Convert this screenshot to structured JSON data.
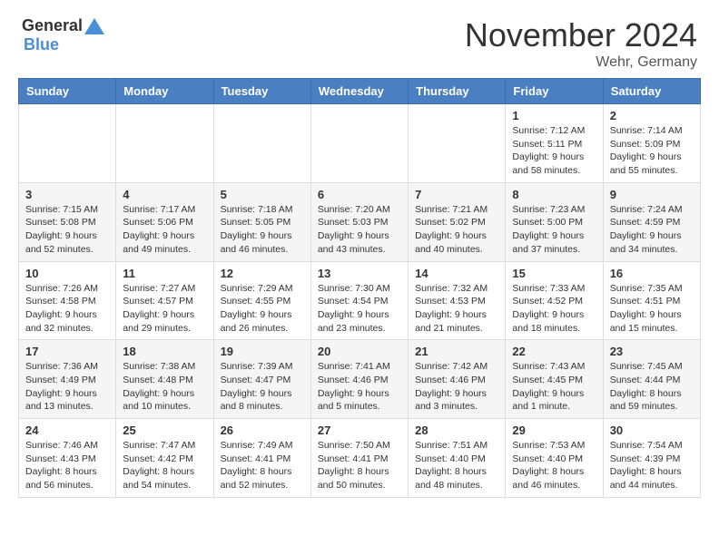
{
  "header": {
    "logo": {
      "general": "General",
      "blue": "Blue"
    },
    "title": "November 2024",
    "location": "Wehr, Germany"
  },
  "calendar": {
    "columns": [
      "Sunday",
      "Monday",
      "Tuesday",
      "Wednesday",
      "Thursday",
      "Friday",
      "Saturday"
    ],
    "weeks": [
      {
        "row": 0,
        "cells": [
          {
            "day": "",
            "info": ""
          },
          {
            "day": "",
            "info": ""
          },
          {
            "day": "",
            "info": ""
          },
          {
            "day": "",
            "info": ""
          },
          {
            "day": "",
            "info": ""
          },
          {
            "day": "1",
            "info": "Sunrise: 7:12 AM\nSunset: 5:11 PM\nDaylight: 9 hours and 58 minutes."
          },
          {
            "day": "2",
            "info": "Sunrise: 7:14 AM\nSunset: 5:09 PM\nDaylight: 9 hours and 55 minutes."
          }
        ]
      },
      {
        "row": 1,
        "cells": [
          {
            "day": "3",
            "info": "Sunrise: 7:15 AM\nSunset: 5:08 PM\nDaylight: 9 hours and 52 minutes."
          },
          {
            "day": "4",
            "info": "Sunrise: 7:17 AM\nSunset: 5:06 PM\nDaylight: 9 hours and 49 minutes."
          },
          {
            "day": "5",
            "info": "Sunrise: 7:18 AM\nSunset: 5:05 PM\nDaylight: 9 hours and 46 minutes."
          },
          {
            "day": "6",
            "info": "Sunrise: 7:20 AM\nSunset: 5:03 PM\nDaylight: 9 hours and 43 minutes."
          },
          {
            "day": "7",
            "info": "Sunrise: 7:21 AM\nSunset: 5:02 PM\nDaylight: 9 hours and 40 minutes."
          },
          {
            "day": "8",
            "info": "Sunrise: 7:23 AM\nSunset: 5:00 PM\nDaylight: 9 hours and 37 minutes."
          },
          {
            "day": "9",
            "info": "Sunrise: 7:24 AM\nSunset: 4:59 PM\nDaylight: 9 hours and 34 minutes."
          }
        ]
      },
      {
        "row": 2,
        "cells": [
          {
            "day": "10",
            "info": "Sunrise: 7:26 AM\nSunset: 4:58 PM\nDaylight: 9 hours and 32 minutes."
          },
          {
            "day": "11",
            "info": "Sunrise: 7:27 AM\nSunset: 4:57 PM\nDaylight: 9 hours and 29 minutes."
          },
          {
            "day": "12",
            "info": "Sunrise: 7:29 AM\nSunset: 4:55 PM\nDaylight: 9 hours and 26 minutes."
          },
          {
            "day": "13",
            "info": "Sunrise: 7:30 AM\nSunset: 4:54 PM\nDaylight: 9 hours and 23 minutes."
          },
          {
            "day": "14",
            "info": "Sunrise: 7:32 AM\nSunset: 4:53 PM\nDaylight: 9 hours and 21 minutes."
          },
          {
            "day": "15",
            "info": "Sunrise: 7:33 AM\nSunset: 4:52 PM\nDaylight: 9 hours and 18 minutes."
          },
          {
            "day": "16",
            "info": "Sunrise: 7:35 AM\nSunset: 4:51 PM\nDaylight: 9 hours and 15 minutes."
          }
        ]
      },
      {
        "row": 3,
        "cells": [
          {
            "day": "17",
            "info": "Sunrise: 7:36 AM\nSunset: 4:49 PM\nDaylight: 9 hours and 13 minutes."
          },
          {
            "day": "18",
            "info": "Sunrise: 7:38 AM\nSunset: 4:48 PM\nDaylight: 9 hours and 10 minutes."
          },
          {
            "day": "19",
            "info": "Sunrise: 7:39 AM\nSunset: 4:47 PM\nDaylight: 9 hours and 8 minutes."
          },
          {
            "day": "20",
            "info": "Sunrise: 7:41 AM\nSunset: 4:46 PM\nDaylight: 9 hours and 5 minutes."
          },
          {
            "day": "21",
            "info": "Sunrise: 7:42 AM\nSunset: 4:46 PM\nDaylight: 9 hours and 3 minutes."
          },
          {
            "day": "22",
            "info": "Sunrise: 7:43 AM\nSunset: 4:45 PM\nDaylight: 9 hours and 1 minute."
          },
          {
            "day": "23",
            "info": "Sunrise: 7:45 AM\nSunset: 4:44 PM\nDaylight: 8 hours and 59 minutes."
          }
        ]
      },
      {
        "row": 4,
        "cells": [
          {
            "day": "24",
            "info": "Sunrise: 7:46 AM\nSunset: 4:43 PM\nDaylight: 8 hours and 56 minutes."
          },
          {
            "day": "25",
            "info": "Sunrise: 7:47 AM\nSunset: 4:42 PM\nDaylight: 8 hours and 54 minutes."
          },
          {
            "day": "26",
            "info": "Sunrise: 7:49 AM\nSunset: 4:41 PM\nDaylight: 8 hours and 52 minutes."
          },
          {
            "day": "27",
            "info": "Sunrise: 7:50 AM\nSunset: 4:41 PM\nDaylight: 8 hours and 50 minutes."
          },
          {
            "day": "28",
            "info": "Sunrise: 7:51 AM\nSunset: 4:40 PM\nDaylight: 8 hours and 48 minutes."
          },
          {
            "day": "29",
            "info": "Sunrise: 7:53 AM\nSunset: 4:40 PM\nDaylight: 8 hours and 46 minutes."
          },
          {
            "day": "30",
            "info": "Sunrise: 7:54 AM\nSunset: 4:39 PM\nDaylight: 8 hours and 44 minutes."
          }
        ]
      }
    ]
  }
}
